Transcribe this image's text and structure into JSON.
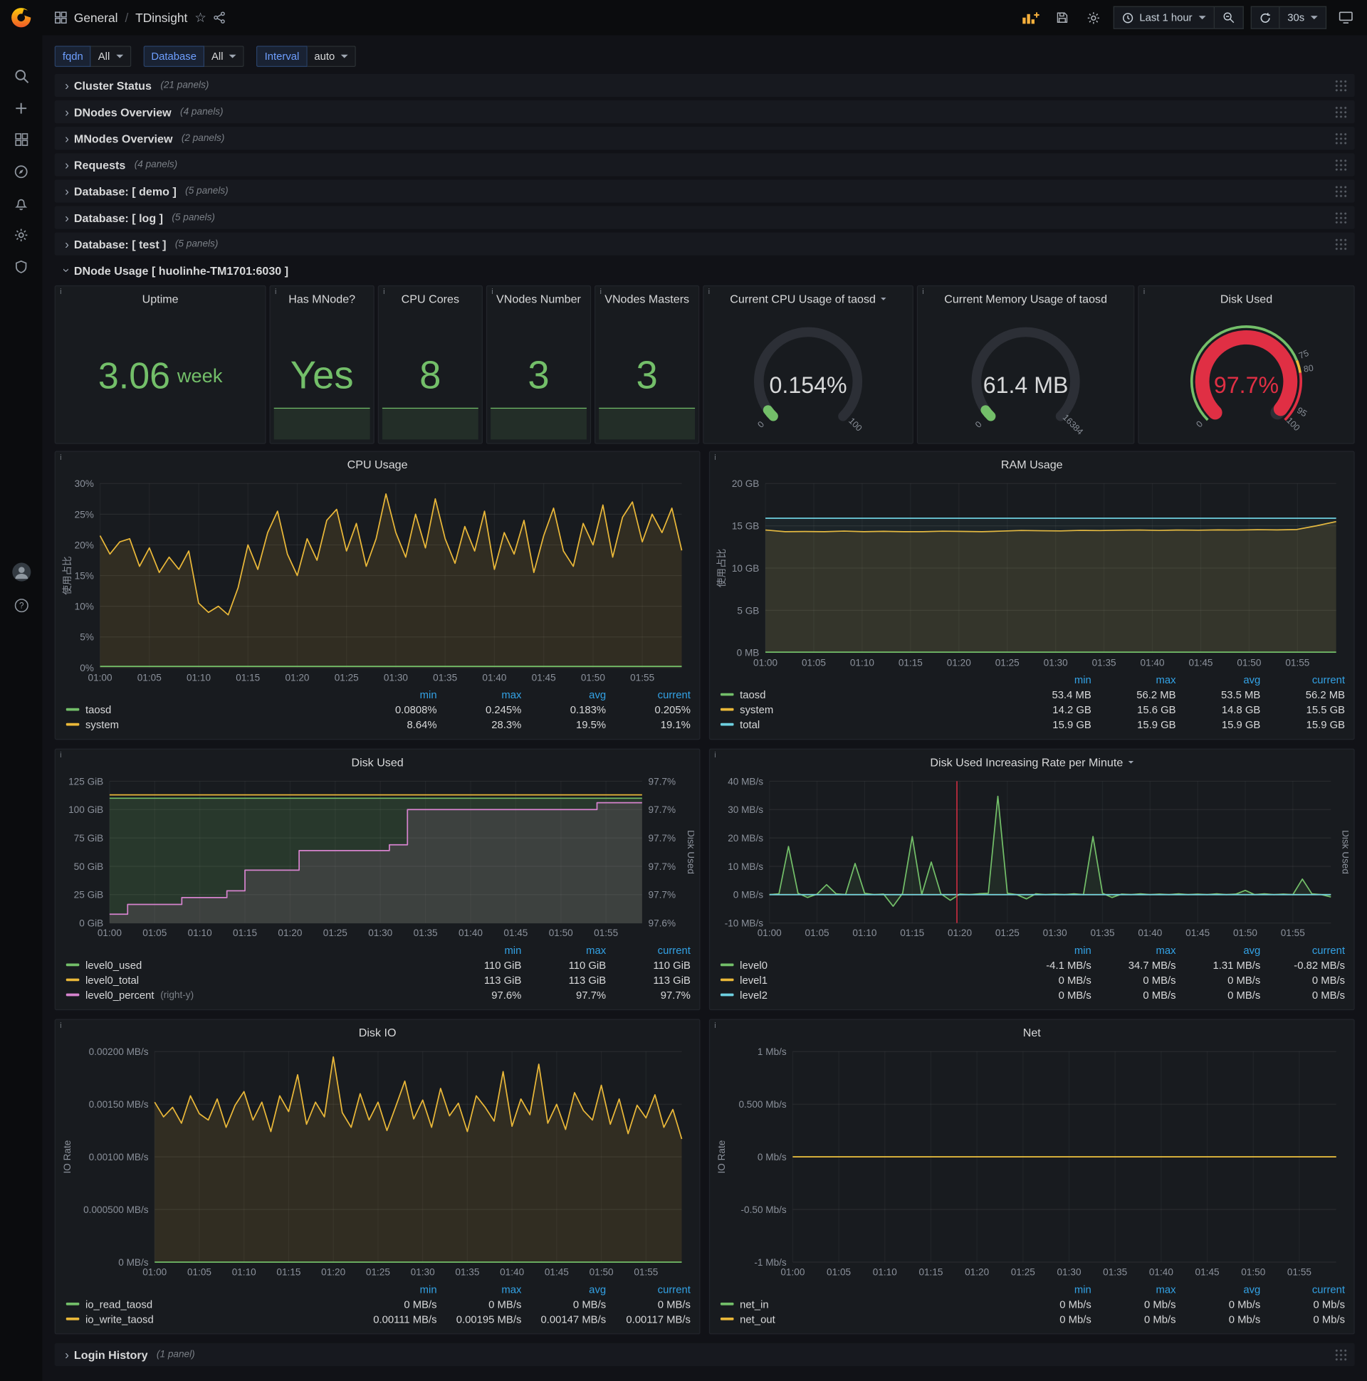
{
  "navbar": {
    "breadcrumb": {
      "section": "General",
      "separator": "/",
      "page": "TDinsight"
    },
    "time_range": "Last 1 hour",
    "refresh_interval": "30s"
  },
  "icons": {
    "sidebar": [
      "grafana-logo",
      "search",
      "create",
      "dashboards",
      "explore",
      "alerting",
      "configuration",
      "server-admin",
      "profile",
      "help"
    ],
    "navbar": [
      "dashboard-grid",
      "star",
      "share",
      "add-panel",
      "save-dashboard",
      "dashboard-settings",
      "clock",
      "zoom-out",
      "refresh",
      "cycle-view"
    ]
  },
  "colors": {
    "green": "#73bf69",
    "yellow": "#eab839",
    "cyan": "#6ed0e0",
    "pink": "#d683ce",
    "red": "#e02f44",
    "legend_header": "#33a2e5"
  },
  "variables": [
    {
      "label": "fqdn",
      "value": "All"
    },
    {
      "label": "Database",
      "value": "All"
    },
    {
      "label": "Interval",
      "value": "auto"
    }
  ],
  "collapsed_rows_top": [
    {
      "title": "Cluster Status",
      "count": "(21 panels)"
    },
    {
      "title": "DNodes Overview",
      "count": "(4 panels)"
    },
    {
      "title": "MNodes Overview",
      "count": "(2 panels)"
    },
    {
      "title": "Requests",
      "count": "(4 panels)"
    },
    {
      "title": "Database: [ demo ]",
      "count": "(5 panels)"
    },
    {
      "title": "Database: [ log ]",
      "count": "(5 panels)"
    },
    {
      "title": "Database: [ test ]",
      "count": "(5 panels)"
    }
  ],
  "expanded_row": {
    "title": "DNode Usage [ huolinhe-TM1701:6030 ]"
  },
  "bottom_row": {
    "title": "Login History",
    "count": "(1 panel)"
  },
  "stats": [
    {
      "title": "Uptime",
      "value": "3.06",
      "suffix": "week"
    },
    {
      "title": "Has MNode?",
      "value": "Yes"
    },
    {
      "title": "CPU Cores",
      "value": "8"
    },
    {
      "title": "VNodes Number",
      "value": "3"
    },
    {
      "title": "VNodes Masters",
      "value": "3"
    }
  ],
  "gauges": [
    {
      "title": "Current CPU Usage of taosd",
      "value": "0.154%",
      "value_color": "#d8d9da",
      "percent": 0.00154,
      "arc_color": "#73bf69",
      "thick": false,
      "tick_labels": [
        {
          "t": 0,
          "text": "0"
        },
        {
          "t": 1,
          "text": "100"
        }
      ]
    },
    {
      "title": "Current Memory Usage of taosd",
      "value": "61.4 MB",
      "value_color": "#d8d9da",
      "percent": 0.0037,
      "arc_color": "#73bf69",
      "thick": false,
      "tick_labels": [
        {
          "t": 0,
          "text": "0"
        },
        {
          "t": 1,
          "text": "16384"
        }
      ]
    },
    {
      "title": "Disk Used",
      "value": "97.7%",
      "value_color": "#e02f44",
      "percent": 0.977,
      "arc_color": "#e02f44",
      "thick": true,
      "threshold_ring": [
        {
          "from": 0,
          "to": 0.75,
          "color": "#73bf69"
        },
        {
          "from": 0.75,
          "to": 0.8,
          "color": "#eab839"
        },
        {
          "from": 0.8,
          "to": 1,
          "color": "#e02f44"
        }
      ],
      "tick_labels": [
        {
          "t": 0,
          "text": "0"
        },
        {
          "t": 0.75,
          "text": "75"
        },
        {
          "t": 0.8,
          "text": "80"
        },
        {
          "t": 0.95,
          "text": "95"
        },
        {
          "t": 1,
          "text": "100"
        }
      ]
    }
  ],
  "time_ticks": [
    "01:00",
    "01:05",
    "01:10",
    "01:15",
    "01:20",
    "01:25",
    "01:30",
    "01:35",
    "01:40",
    "01:45",
    "01:50",
    "01:55"
  ],
  "chart_data": [
    {
      "type": "line",
      "title": "CPU Usage",
      "ylabel": "使用占比",
      "y": {
        "min": 0,
        "max": 30,
        "ticks": [
          "0%",
          "5%",
          "10%",
          "15%",
          "20%",
          "25%",
          "30%"
        ]
      },
      "series": [
        {
          "name": "system",
          "color": "#eab839",
          "fill": 0.12,
          "values": [
            21.5,
            18.5,
            20.5,
            21,
            16.5,
            19.5,
            15.5,
            18,
            16,
            19,
            10.5,
            9,
            10,
            8.6,
            13,
            20,
            16,
            22,
            25.5,
            18.5,
            15,
            21,
            17.5,
            24,
            25.8,
            19,
            23.5,
            16.5,
            21,
            28.3,
            22,
            18,
            25,
            19.5,
            27.5,
            21,
            17,
            23,
            19,
            25.5,
            16,
            22,
            18.5,
            24,
            15.5,
            21.5,
            26,
            19,
            16.5,
            23.5,
            20,
            26.5,
            18,
            24.5,
            27,
            20.5,
            25,
            22,
            26,
            19.1
          ]
        },
        {
          "name": "taosd",
          "color": "#73bf69",
          "const": 0.2
        }
      ],
      "legend": {
        "columns": [
          "min",
          "max",
          "avg",
          "current"
        ],
        "rows": [
          {
            "name": "taosd",
            "color": "#73bf69",
            "values": [
              "0.0808%",
              "0.245%",
              "0.183%",
              "0.205%"
            ]
          },
          {
            "name": "system",
            "color": "#eab839",
            "values": [
              "8.64%",
              "28.3%",
              "19.5%",
              "19.1%"
            ]
          }
        ]
      }
    },
    {
      "type": "line",
      "title": "RAM Usage",
      "ylabel": "使用占比",
      "y": {
        "min": 0,
        "max": 20,
        "ticks": [
          "0 MB",
          "5 GB",
          "10 GB",
          "15 GB",
          "20 GB"
        ]
      },
      "series": [
        {
          "name": "system",
          "color": "#eab839",
          "fill": 0.12,
          "values": [
            14.5,
            14.3,
            14.32,
            14.3,
            14.38,
            14.3,
            14.34,
            14.3,
            14.3,
            14.36,
            14.33,
            14.3,
            14.38,
            14.45,
            14.42,
            14.4,
            14.46,
            14.44,
            14.48,
            14.5,
            14.46,
            14.5,
            14.48,
            14.52,
            14.5,
            14.54,
            14.52,
            14.56,
            15.0,
            15.5
          ]
        },
        {
          "name": "total",
          "color": "#6ed0e0",
          "fill": 0.05,
          "const": 15.9
        },
        {
          "name": "taosd",
          "color": "#73bf69",
          "const": 0.055
        }
      ],
      "legend": {
        "columns": [
          "min",
          "max",
          "avg",
          "current"
        ],
        "rows": [
          {
            "name": "taosd",
            "color": "#73bf69",
            "values": [
              "53.4 MB",
              "56.2 MB",
              "53.5 MB",
              "56.2 MB"
            ]
          },
          {
            "name": "system",
            "color": "#eab839",
            "values": [
              "14.2 GB",
              "15.6 GB",
              "14.8 GB",
              "15.5 GB"
            ]
          },
          {
            "name": "total",
            "color": "#6ed0e0",
            "values": [
              "15.9 GB",
              "15.9 GB",
              "15.9 GB",
              "15.9 GB"
            ]
          }
        ]
      }
    },
    {
      "type": "line",
      "title": "Disk Used",
      "y": {
        "min": 0,
        "max": 125,
        "ticks": [
          "0 GiB",
          "25 GiB",
          "50 GiB",
          "75 GiB",
          "100 GiB",
          "125 GiB"
        ]
      },
      "right_axis": {
        "min": 97.58,
        "max": 97.725
      },
      "right_ticks": [
        "97.6%",
        "97.7%",
        "97.7%",
        "97.7%",
        "97.7%",
        "97.7%"
      ],
      "right_label": "Disk Used",
      "series": [
        {
          "name": "level0_used",
          "color": "#73bf69",
          "fill": 0.18,
          "const": 110
        },
        {
          "name": "level0_total",
          "color": "#eab839",
          "const": 113
        },
        {
          "name": "level0_percent",
          "color": "#d683ce",
          "right": true,
          "step": true,
          "fill": 0.12,
          "values": [
            97.589,
            97.589,
            97.599,
            97.599,
            97.599,
            97.599,
            97.599,
            97.599,
            97.606,
            97.606,
            97.606,
            97.606,
            97.606,
            97.613,
            97.613,
            97.634,
            97.634,
            97.634,
            97.634,
            97.634,
            97.634,
            97.654,
            97.654,
            97.654,
            97.654,
            97.654,
            97.654,
            97.654,
            97.654,
            97.654,
            97.654,
            97.66,
            97.66,
            97.696,
            97.696,
            97.696,
            97.696,
            97.696,
            97.696,
            97.696,
            97.696,
            97.696,
            97.696,
            97.696,
            97.696,
            97.696,
            97.696,
            97.696,
            97.696,
            97.696,
            97.696,
            97.696,
            97.696,
            97.696,
            97.703,
            97.703,
            97.703,
            97.703,
            97.703,
            97.703
          ]
        }
      ],
      "legend": {
        "columns": [
          "min",
          "max",
          "current"
        ],
        "rows": [
          {
            "name": "level0_used",
            "color": "#73bf69",
            "values": [
              "110 GiB",
              "110 GiB",
              "110 GiB"
            ]
          },
          {
            "name": "level0_total",
            "color": "#eab839",
            "values": [
              "113 GiB",
              "113 GiB",
              "113 GiB"
            ]
          },
          {
            "name": "level0_percent",
            "suffix": "(right-y)",
            "color": "#d683ce",
            "values": [
              "97.6%",
              "97.7%",
              "97.7%"
            ]
          }
        ]
      }
    },
    {
      "type": "line",
      "title": "Disk Used Increasing Rate per Minute",
      "title_caret": true,
      "y": {
        "min": -10,
        "max": 40,
        "ticks": [
          "-10 MB/s",
          "0 MB/s",
          "10 MB/s",
          "20 MB/s",
          "30 MB/s",
          "40 MB/s"
        ]
      },
      "right_label": "Disk Used",
      "fill_to_zero": true,
      "annotations": [
        {
          "x": 19.7,
          "color": "#e02f44"
        }
      ],
      "series": [
        {
          "name": "level0",
          "color": "#73bf69",
          "fill": 0.1,
          "values": [
            0,
            0.3,
            17,
            0.5,
            -1,
            0.2,
            3.5,
            0.3,
            0,
            11,
            0.5,
            0,
            0.2,
            -4.1,
            0.5,
            20.5,
            0,
            11.5,
            0.3,
            -2,
            0.2,
            0,
            0.3,
            0.5,
            34.7,
            0.5,
            0,
            -1.5,
            0.3,
            0,
            0.2,
            0,
            0.3,
            0,
            20.5,
            0.5,
            -1,
            0.2,
            0,
            0.3,
            0,
            0.2,
            0,
            0.3,
            0,
            0.2,
            0,
            0.3,
            0,
            0.2,
            1.5,
            0,
            0.3,
            0,
            0.2,
            0,
            5.5,
            0.3,
            0,
            -0.82
          ]
        },
        {
          "name": "level1",
          "color": "#eab839",
          "const": 0
        },
        {
          "name": "level2",
          "color": "#6ed0e0",
          "const": 0
        }
      ],
      "legend": {
        "columns": [
          "min",
          "max",
          "avg",
          "current"
        ],
        "rows": [
          {
            "name": "level0",
            "color": "#73bf69",
            "values": [
              "-4.1 MB/s",
              "34.7 MB/s",
              "1.31 MB/s",
              "-0.82 MB/s"
            ]
          },
          {
            "name": "level1",
            "color": "#eab839",
            "values": [
              "0 MB/s",
              "0 MB/s",
              "0 MB/s",
              "0 MB/s"
            ]
          },
          {
            "name": "level2",
            "color": "#6ed0e0",
            "values": [
              "0 MB/s",
              "0 MB/s",
              "0 MB/s",
              "0 MB/s"
            ]
          }
        ]
      }
    },
    {
      "type": "line",
      "title": "Disk IO",
      "ylabel": "IO Rate",
      "y": {
        "min": 0,
        "max": 0.002,
        "ticks": [
          "0 MB/s",
          "0.000500 MB/s",
          "0.00100 MB/s",
          "0.00150 MB/s",
          "0.00200 MB/s"
        ]
      },
      "series": [
        {
          "name": "io_write_taosd",
          "color": "#eab839",
          "fill": 0.12,
          "values": [
            0.00152,
            0.00138,
            0.00147,
            0.00132,
            0.00158,
            0.00141,
            0.00135,
            0.00155,
            0.00128,
            0.00149,
            0.00162,
            0.00135,
            0.00152,
            0.00124,
            0.00158,
            0.00143,
            0.00178,
            0.00131,
            0.00152,
            0.00138,
            0.00195,
            0.00142,
            0.00128,
            0.0016,
            0.00135,
            0.00152,
            0.00125,
            0.00148,
            0.00172,
            0.00136,
            0.00154,
            0.00128,
            0.00165,
            0.00139,
            0.00151,
            0.00124,
            0.00158,
            0.00147,
            0.00134,
            0.00181,
            0.00129,
            0.00155,
            0.0014,
            0.00188,
            0.00132,
            0.0015,
            0.00126,
            0.00161,
            0.00144,
            0.00135,
            0.00168,
            0.00131,
            0.00155,
            0.00122,
            0.00149,
            0.00137,
            0.00159,
            0.00128,
            0.00145,
            0.00117
          ]
        },
        {
          "name": "io_read_taosd",
          "color": "#73bf69",
          "const": 0
        }
      ],
      "legend": {
        "columns": [
          "min",
          "max",
          "avg",
          "current"
        ],
        "rows": [
          {
            "name": "io_read_taosd",
            "color": "#73bf69",
            "values": [
              "0 MB/s",
              "0 MB/s",
              "0 MB/s",
              "0 MB/s"
            ]
          },
          {
            "name": "io_write_taosd",
            "color": "#eab839",
            "values": [
              "0.00111 MB/s",
              "0.00195 MB/s",
              "0.00147 MB/s",
              "0.00117 MB/s"
            ]
          }
        ]
      }
    },
    {
      "type": "line",
      "title": "Net",
      "ylabel": "IO Rate",
      "y": {
        "min": -1,
        "max": 1,
        "ticks": [
          "-1 Mb/s",
          "-0.50 Mb/s",
          "0 Mb/s",
          "0.500 Mb/s",
          "1 Mb/s"
        ]
      },
      "series": [
        {
          "name": "net_in",
          "color": "#73bf69",
          "const": 0
        },
        {
          "name": "net_out",
          "color": "#eab839",
          "const": 0
        }
      ],
      "legend": {
        "columns": [
          "min",
          "max",
          "avg",
          "current"
        ],
        "rows": [
          {
            "name": "net_in",
            "color": "#73bf69",
            "values": [
              "0 Mb/s",
              "0 Mb/s",
              "0 Mb/s",
              "0 Mb/s"
            ]
          },
          {
            "name": "net_out",
            "color": "#eab839",
            "values": [
              "0 Mb/s",
              "0 Mb/s",
              "0 Mb/s",
              "0 Mb/s"
            ]
          }
        ]
      }
    }
  ]
}
